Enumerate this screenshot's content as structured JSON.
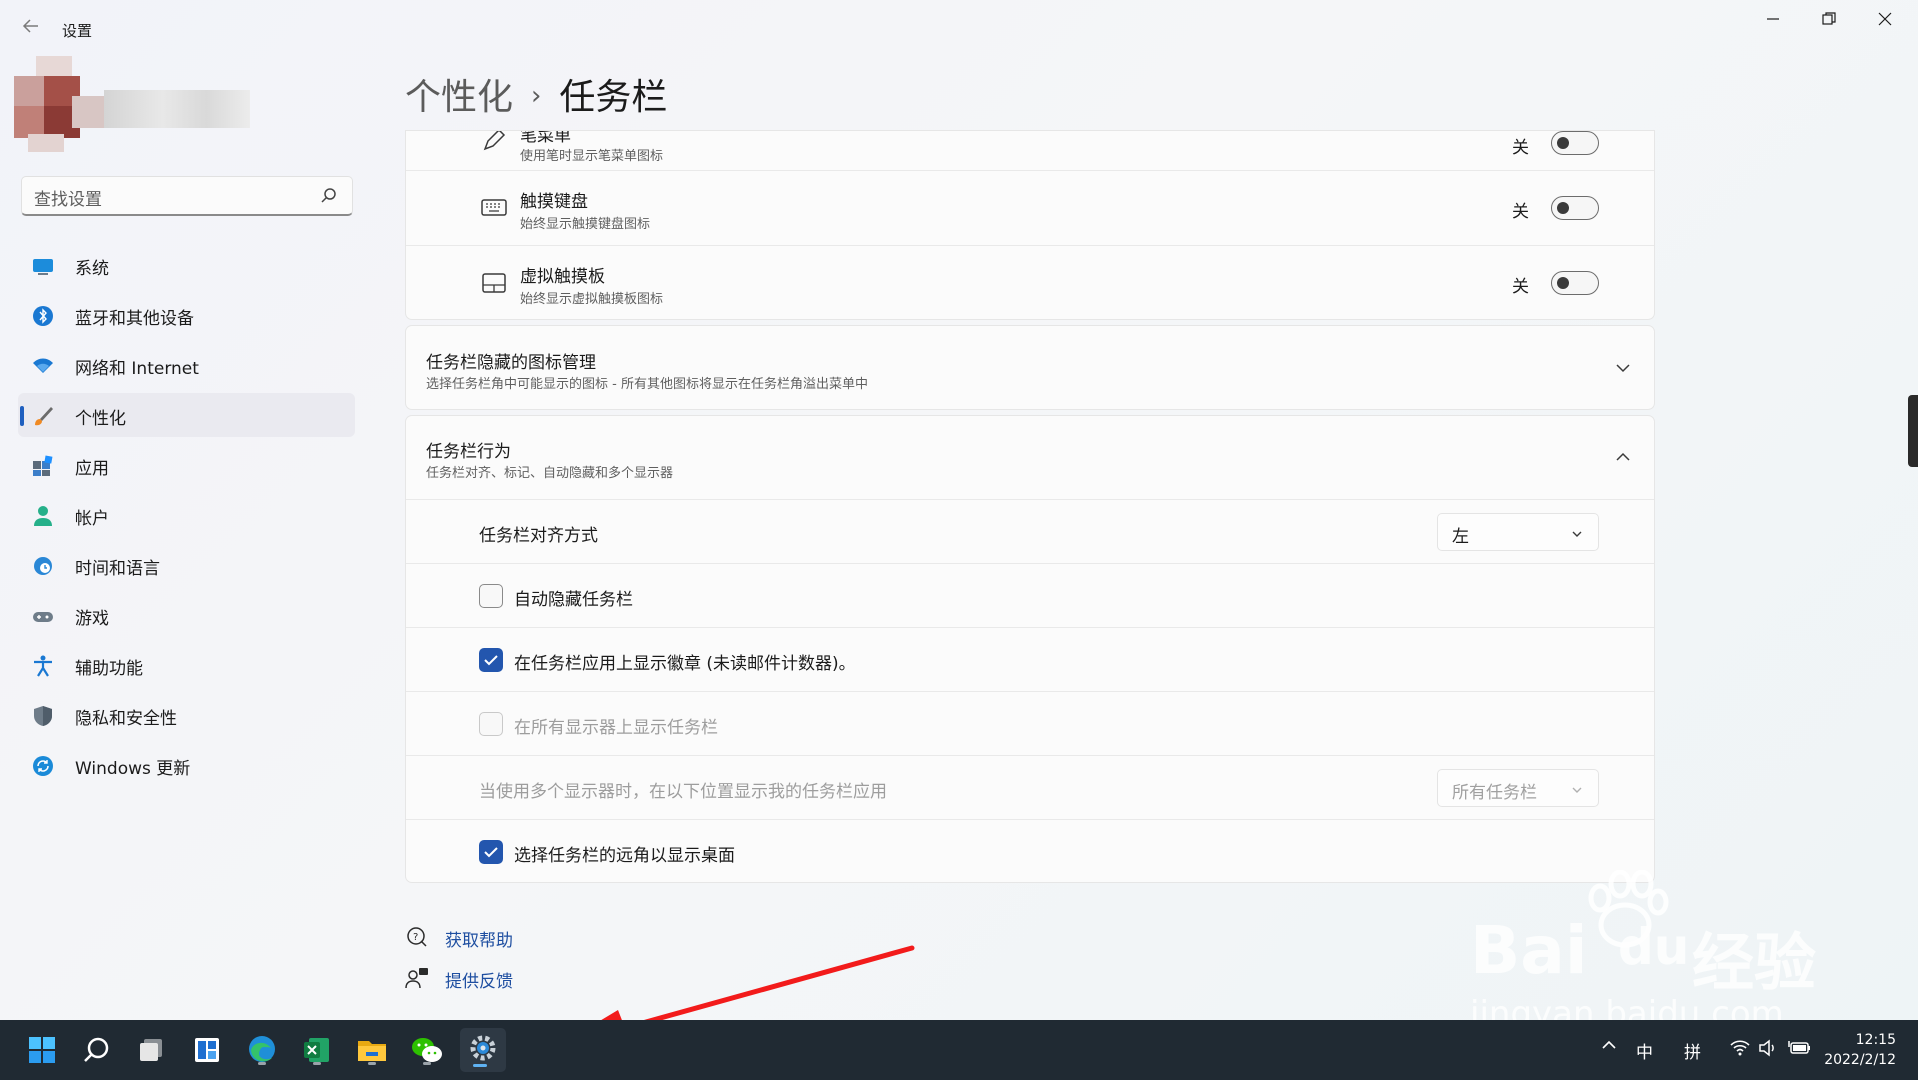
{
  "window": {
    "title": "设置",
    "back_icon": "back-arrow-icon",
    "minimize": "—",
    "restore": "❐",
    "close": "✕"
  },
  "search": {
    "placeholder": "查找设置",
    "icon": "search-icon"
  },
  "sidebar": {
    "items": [
      {
        "label": "系统",
        "icon": "monitor-icon",
        "selected": false
      },
      {
        "label": "蓝牙和其他设备",
        "icon": "bluetooth-icon",
        "selected": false
      },
      {
        "label": "网络和 Internet",
        "icon": "wifi-icon",
        "selected": false
      },
      {
        "label": "个性化",
        "icon": "paintbrush-icon",
        "selected": true
      },
      {
        "label": "应用",
        "icon": "apps-icon",
        "selected": false
      },
      {
        "label": "帐户",
        "icon": "user-icon",
        "selected": false
      },
      {
        "label": "时间和语言",
        "icon": "clock-globe-icon",
        "selected": false
      },
      {
        "label": "游戏",
        "icon": "gamepad-icon",
        "selected": false
      },
      {
        "label": "辅助功能",
        "icon": "accessibility-icon",
        "selected": false
      },
      {
        "label": "隐私和安全性",
        "icon": "shield-icon",
        "selected": false
      },
      {
        "label": "Windows 更新",
        "icon": "update-icon",
        "selected": false
      }
    ]
  },
  "breadcrumb": {
    "parent": "个性化",
    "separator": "›",
    "current": "任务栏"
  },
  "corner_icons": {
    "rows": [
      {
        "title": "笔菜单",
        "desc": "使用笔时显示笔菜单图标",
        "state": "关",
        "icon": "pen-icon",
        "on": false
      },
      {
        "title": "触摸键盘",
        "desc": "始终显示触摸键盘图标",
        "state": "关",
        "icon": "keyboard-icon",
        "on": false
      },
      {
        "title": "虚拟触摸板",
        "desc": "始终显示虚拟触摸板图标",
        "state": "关",
        "icon": "touchpad-icon",
        "on": false
      }
    ]
  },
  "overflow_section": {
    "title": "任务栏隐藏的图标管理",
    "desc": "选择任务栏角中可能显示的图标 - 所有其他图标将显示在任务栏角溢出菜单中",
    "expanded": false
  },
  "behaviors": {
    "title": "任务栏行为",
    "desc": "任务栏对齐、标记、自动隐藏和多个显示器",
    "expanded": true,
    "alignment": {
      "label": "任务栏对齐方式",
      "value": "左"
    },
    "auto_hide": {
      "label": "自动隐藏任务栏",
      "checked": false,
      "disabled": false
    },
    "badges": {
      "label": "在任务栏应用上显示徽章 (未读邮件计数器)。",
      "checked": true,
      "disabled": false
    },
    "all_displays": {
      "label": "在所有显示器上显示任务栏",
      "checked": false,
      "disabled": true
    },
    "multi_display": {
      "label": "当使用多个显示器时，在以下位置显示我的任务栏应用",
      "value": "所有任务栏",
      "disabled": true
    },
    "far_corner": {
      "label": "选择任务栏的远角以显示桌面",
      "checked": true,
      "disabled": false
    }
  },
  "help_links": {
    "get_help": "获取帮助",
    "feedback": "提供反馈"
  },
  "taskbar": {
    "apps": [
      {
        "name": "start-icon",
        "running": false,
        "active": false
      },
      {
        "name": "search-icon",
        "running": false,
        "active": false
      },
      {
        "name": "task-view-icon",
        "running": false,
        "active": false
      },
      {
        "name": "widgets-icon",
        "running": false,
        "active": false
      },
      {
        "name": "edge-icon",
        "running": true,
        "active": false
      },
      {
        "name": "excel-icon",
        "running": true,
        "active": false
      },
      {
        "name": "file-explorer-icon",
        "running": true,
        "active": false
      },
      {
        "name": "wechat-icon",
        "running": true,
        "active": false
      },
      {
        "name": "settings-icon",
        "running": true,
        "active": true
      }
    ],
    "tray": {
      "ime_mode": "中",
      "ime_name": "拼",
      "time": "12:15",
      "date": "2022/2/12"
    }
  },
  "watermark": {
    "brand": "Bai",
    "brand_du": "du",
    "product": "经验",
    "url": "jingyan.baidu.com"
  },
  "colors": {
    "accent": "#2356ae",
    "link": "#1f4fa1",
    "taskbar": "#202a33",
    "arrow": "#f21b1b"
  }
}
